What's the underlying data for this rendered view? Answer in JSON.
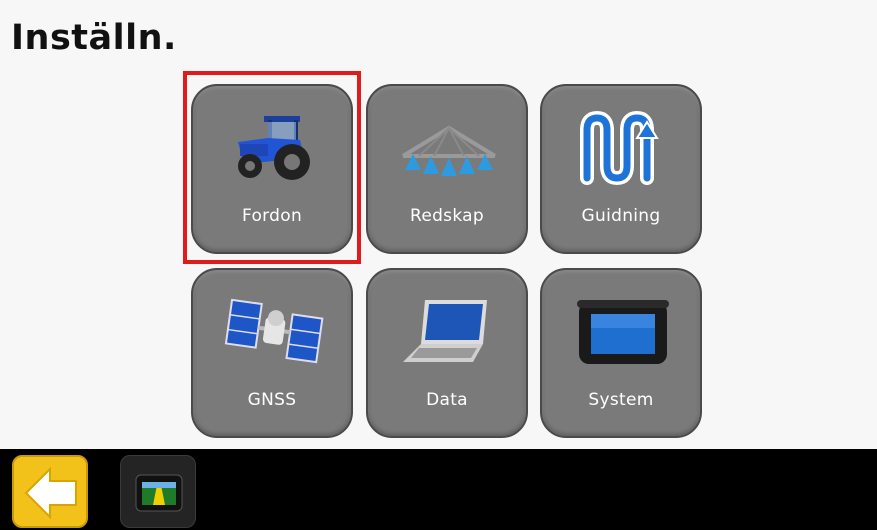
{
  "page": {
    "title": "Inställn."
  },
  "tiles": [
    {
      "label": "Fordon",
      "icon": "tractor-icon",
      "selected": true
    },
    {
      "label": "Redskap",
      "icon": "implement-boom-icon"
    },
    {
      "label": "Guidning",
      "icon": "guidance-path-icon"
    },
    {
      "label": "GNSS",
      "icon": "satellite-icon"
    },
    {
      "label": "Data",
      "icon": "laptop-icon"
    },
    {
      "label": "System",
      "icon": "display-console-icon"
    }
  ],
  "bottom_bar": {
    "back_icon": "back-arrow-icon",
    "home_icon": "guidance-screen-icon"
  },
  "colors": {
    "tile": "#7a7a7a",
    "selection": "#e01b1b",
    "back_button": "#f2c21a",
    "bar": "#000000"
  }
}
